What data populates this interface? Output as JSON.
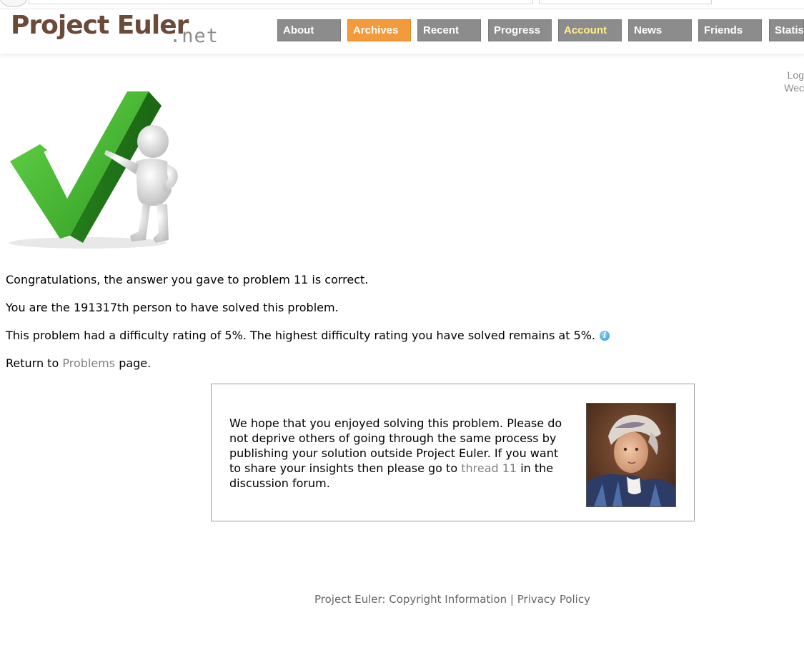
{
  "site": {
    "logo_main": "Project Euler",
    "logo_net": ".net"
  },
  "nav": {
    "items": [
      {
        "label": "About"
      },
      {
        "label": "Archives"
      },
      {
        "label": "Recent"
      },
      {
        "label": "Progress"
      },
      {
        "label": "Account"
      },
      {
        "label": "News"
      },
      {
        "label": "Friends"
      },
      {
        "label": "Statist"
      }
    ],
    "active": "Archives",
    "highlighted": "Account"
  },
  "login_edge": {
    "line1": "Log",
    "line2": "Wec"
  },
  "result": {
    "congrats": "Congratulations, the answer you gave to problem 11 is correct.",
    "person": "You are the 191317th person to have solved this problem.",
    "difficulty": "This problem had a difficulty rating of 5%. The highest difficulty rating you have solved remains at 5%.",
    "return_prefix": "Return to",
    "return_link": "Problems",
    "return_suffix": "page."
  },
  "message": {
    "text_before": "We hope that you enjoyed solving this problem. Please do not deprive others of going through the same process by publishing your solution outside Project Euler. If you want to share your insights then please go to",
    "thread_link": "thread 11",
    "text_after": "in the discussion forum."
  },
  "footer": {
    "prefix": "Project Euler:",
    "copyright": "Copyright Information",
    "separator": "|",
    "privacy": "Privacy Policy"
  },
  "colors": {
    "nav_bg": "#8c8c8c",
    "nav_active": "#f39a3b",
    "nav_highlight_text": "#ffef82",
    "logo_brown": "#6b4a3a",
    "link_gray": "#808080",
    "check_green": "#3fae2a"
  },
  "icons": {
    "info": "info-icon",
    "check": "checkmark-figure",
    "portrait": "euler-portrait"
  }
}
